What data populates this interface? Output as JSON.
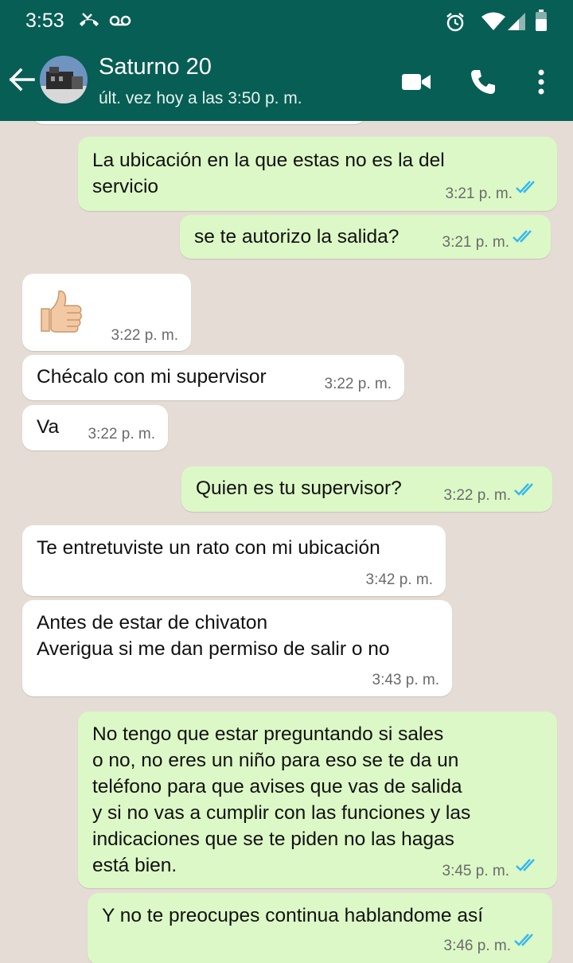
{
  "status_bar": {
    "time": "3:53",
    "icons": [
      "missed-call-icon",
      "voicemail-icon",
      "alarm-icon",
      "wifi-icon",
      "signal-icon",
      "battery-icon"
    ]
  },
  "header": {
    "contact_name": "Saturno 20",
    "last_seen": "últ. vez hoy a las 3:50 p. m.",
    "icons": [
      "back-arrow-icon",
      "video-call-icon",
      "phone-call-icon",
      "more-options-icon"
    ]
  },
  "colors": {
    "header_bg": "#075e54",
    "chat_bg": "#e5ddd5",
    "outgoing_bubble": "#dcf8c6",
    "incoming_bubble": "#ffffff",
    "read_ticks": "#34b7f1"
  },
  "messages": [
    {
      "dir": "out",
      "text": "La ubicación en la que estas no es la del\nservicio",
      "time": "3:21 p. m.",
      "read": true
    },
    {
      "dir": "out",
      "text": "se te autorizo la salida?",
      "time": "3:21 p. m.",
      "read": true
    },
    {
      "dir": "in",
      "emoji": "thumbs-up-emoji",
      "time": "3:22 p. m."
    },
    {
      "dir": "in",
      "text": "Chécalo con mi supervisor",
      "time": "3:22 p. m."
    },
    {
      "dir": "in",
      "text": "Va",
      "time": "3:22 p. m."
    },
    {
      "dir": "out",
      "text": "Quien es tu supervisor?",
      "time": "3:22 p. m.",
      "read": true
    },
    {
      "dir": "in",
      "text": "Te entretuviste un rato con mi ubicación",
      "time": "3:42 p. m."
    },
    {
      "dir": "in",
      "text": "Antes de estar de chivaton\nAverigua si me dan permiso de salir o no",
      "time": "3:43 p. m."
    },
    {
      "dir": "out",
      "text": "No tengo que estar preguntando si sales\no no, no eres un niño para eso se te da un\nteléfono para que avises que vas de salida\ny si no vas a cumplir con las funciones y las\nindicaciones que se te piden no las hagas\nestá bien.",
      "time": "3:45 p. m.",
      "read": true
    },
    {
      "dir": "out",
      "text": "Y no te preocupes continua hablandome así",
      "time": "3:46 p. m.",
      "read": true
    }
  ]
}
